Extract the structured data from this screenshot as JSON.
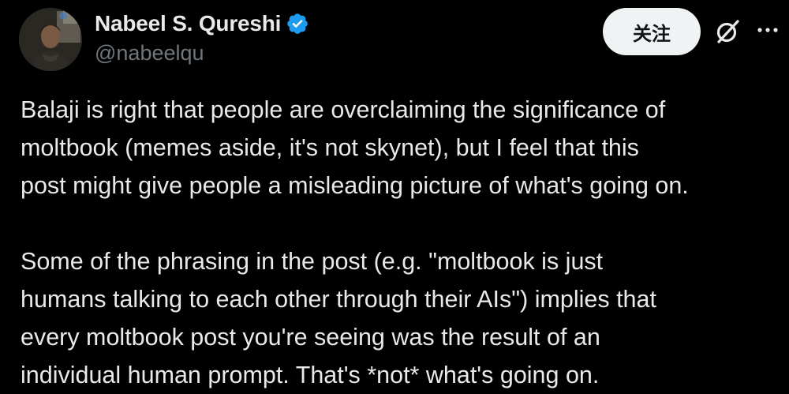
{
  "author": {
    "display_name": "Nabeel S. Qureshi",
    "handle": "@nabeelqu",
    "verified": true
  },
  "actions": {
    "follow_label": "关注",
    "grok_icon": "grok-icon",
    "more_icon": "more-icon"
  },
  "tweet": {
    "paragraphs": [
      {
        "lines": [
          "Balaji is right that people are overclaiming the significance of",
          "moltbook (memes aside, it's not skynet), but I feel that this",
          "post might give people a misleading picture of what's going on."
        ]
      },
      {
        "lines": [
          "Some of the phrasing in the post (e.g. \"moltbook is just",
          "humans talking to each other through their AIs\") implies that",
          "every moltbook post you're seeing was the result of an",
          "individual human prompt. That's *not* what's going on."
        ]
      }
    ]
  },
  "colors": {
    "background": "#000000",
    "text_primary": "#e7e9ea",
    "text_secondary": "#71767b",
    "verified_blue": "#1d9bf0",
    "follow_bg": "#eff3f4",
    "follow_text": "#0f1419"
  }
}
